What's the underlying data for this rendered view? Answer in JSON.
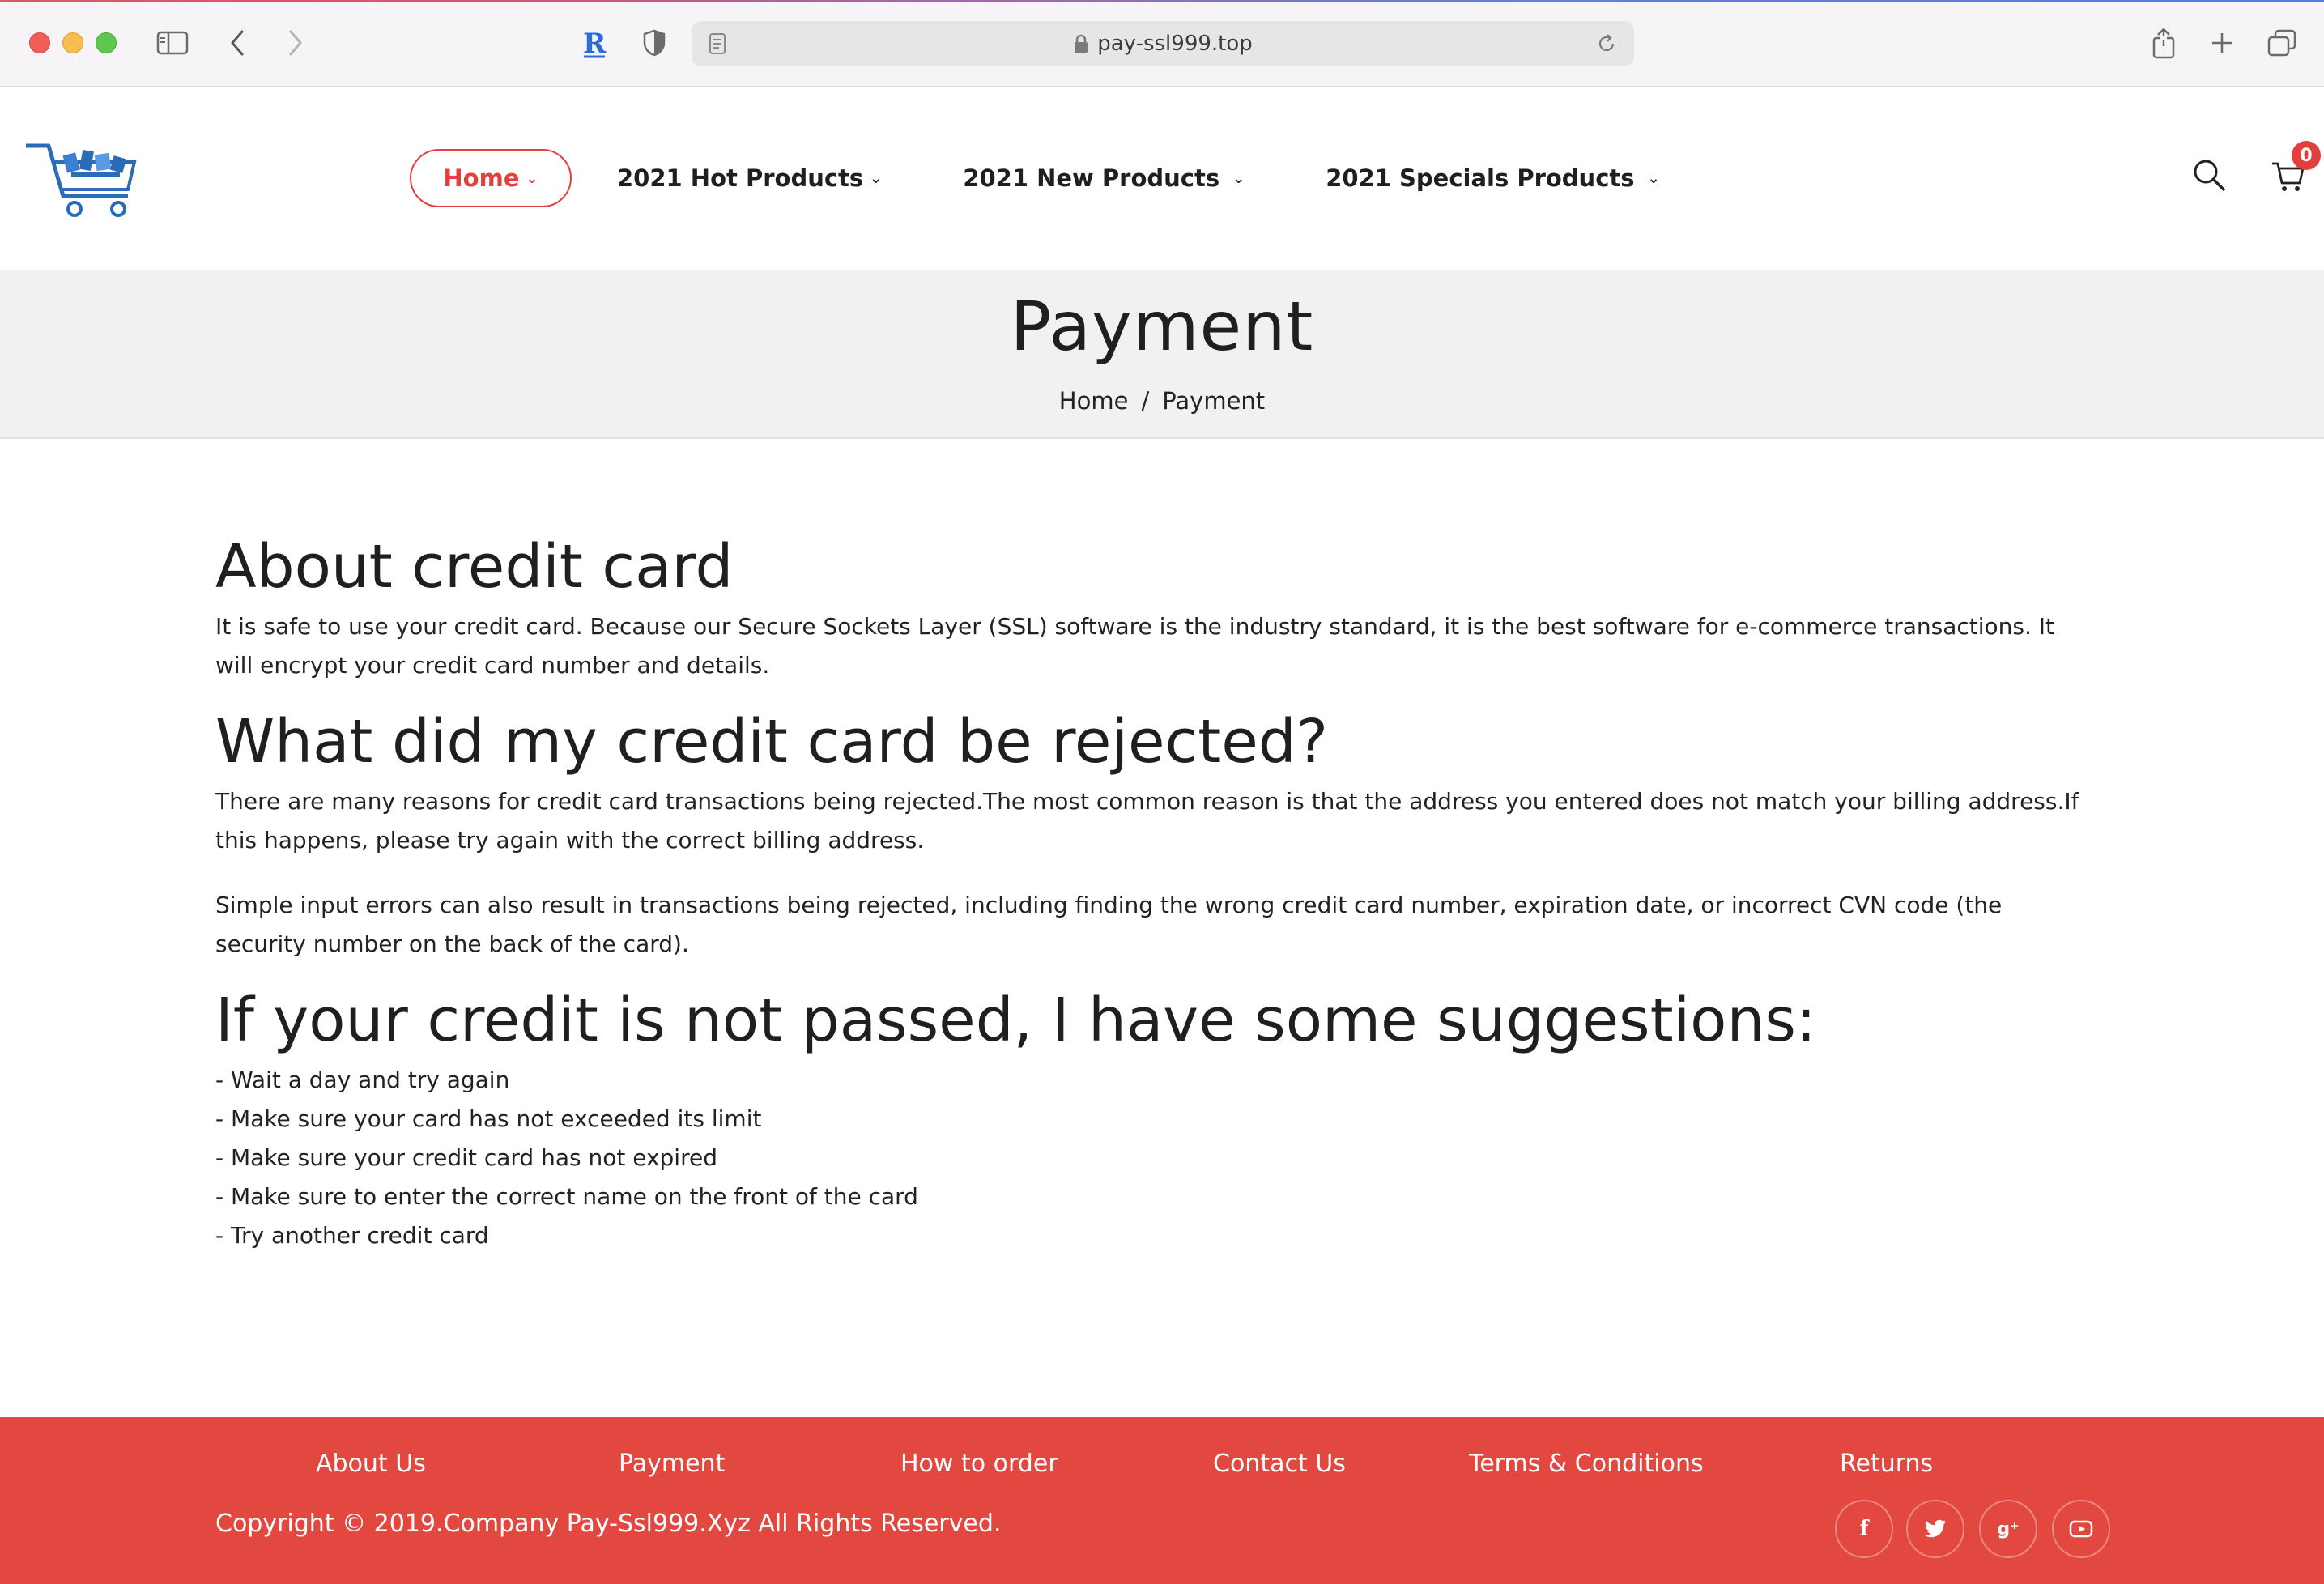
{
  "browser": {
    "url": "pay-ssl999.top",
    "icons": [
      "sidebar-toggle-icon",
      "back-icon",
      "forward-icon",
      "extension-r-icon",
      "privacy-shield-icon",
      "page-icon",
      "lock-icon",
      "reload-icon",
      "share-icon",
      "new-tab-icon",
      "tabs-overview-icon"
    ]
  },
  "header": {
    "logo": "shopping-cart-logo",
    "nav": [
      {
        "label": "Home",
        "active": true
      },
      {
        "label": "2021 Hot Products"
      },
      {
        "label": "2021 New Products"
      },
      {
        "label": "2021 Specials Products"
      }
    ],
    "cart_count": "0",
    "accent_color": "#e3403d"
  },
  "title_band": {
    "title": "Payment",
    "breadcrumb": {
      "home": "Home",
      "separator": "/",
      "current": "Payment"
    }
  },
  "content": {
    "about": {
      "heading": "About credit card",
      "text": "It is safe to use your credit card. Because our Secure Sockets Layer (SSL) software is the industry standard, it is the best software for e-commerce transactions. It will encrypt your credit card number and details."
    },
    "rejected": {
      "heading": "What did my credit card be rejected?",
      "text1": "There are many reasons for credit card transactions being rejected.The most common reason is that the address you entered does not match your billing address.If this happens, please try again with the correct billing address.",
      "text2": "Simple input errors can also result in transactions being rejected, including finding the wrong credit card number, expiration date, or incorrect CVN code (the security number on the back of the card)."
    },
    "suggestions": {
      "heading": "If your credit is not passed, I have some suggestions:",
      "items": [
        "- Wait a day and try again",
        "- Make sure your card has not exceeded its limit",
        "- Make sure your credit card has not expired",
        "- Make sure to enter the correct name on the front of the card",
        "- Try another credit card"
      ]
    }
  },
  "footer": {
    "links": [
      "About Us",
      "Payment",
      "How to order",
      "Contact Us",
      "Terms & Conditions",
      "Returns"
    ],
    "copyright": "Copyright © 2019.Company Pay-Ssl999.Xyz All Rights Reserved.",
    "social": [
      {
        "icon": "facebook-icon",
        "glyph": "f"
      },
      {
        "icon": "twitter-icon"
      },
      {
        "icon": "google-plus-icon",
        "glyph": "g⁺"
      },
      {
        "icon": "youtube-icon"
      }
    ],
    "background_color": "#e34840"
  }
}
